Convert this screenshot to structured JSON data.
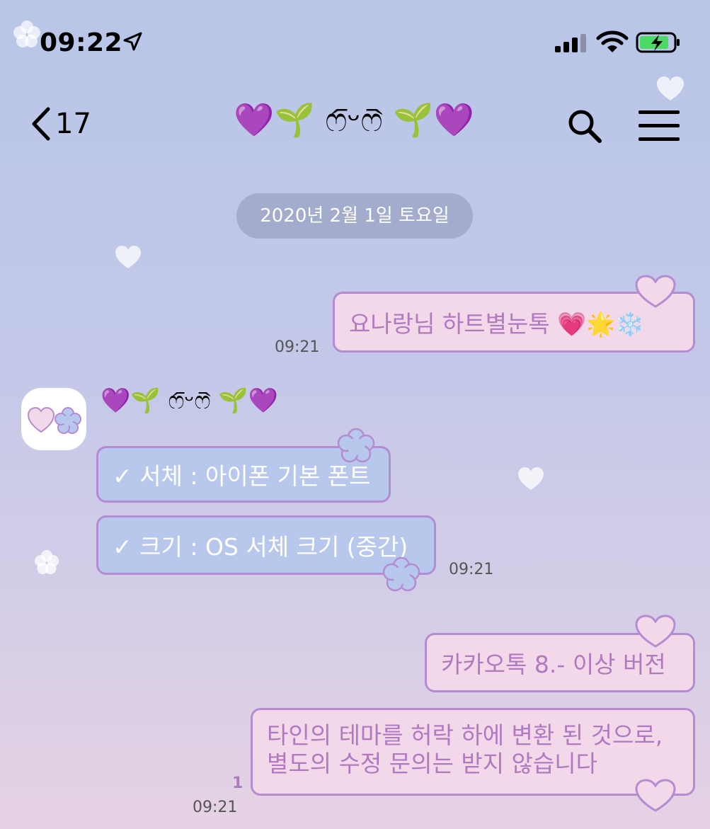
{
  "status_bar": {
    "time": "09:22"
  },
  "nav": {
    "back_count": "17",
    "title": "💜🌱 ෆ᷇ᵕෆ᷆ 🌱💜"
  },
  "date_separator": "2020년 2월 1일 토요일",
  "messages": [
    {
      "sender": "me",
      "text": "요나랑님 하트별눈톡 💗🌟❄️",
      "time": "09:21"
    },
    {
      "sender": "other",
      "name": "💜🌱 ෆ᷇ᵕෆ᷆ 🌱💜",
      "text": "✓ 서체 : 아이폰 기본 폰트"
    },
    {
      "sender": "other",
      "text": "✓ 크기 : OS 서체 크기 (중간)",
      "time": "09:21"
    },
    {
      "sender": "me",
      "text": "카카오톡 8.- 이상 버전"
    },
    {
      "sender": "me",
      "text": "타인의 테마를 허락 하에 변환 된 것으로, 별도의 수정 문의는 받지 않습니다",
      "time": "09:21",
      "unread": "1"
    }
  ],
  "colors": {
    "my_bubble": "#f2d8e8",
    "other_bubble": "#b8c8ec",
    "bubble_border": "#b48cd2",
    "my_text": "#b07ac0"
  }
}
